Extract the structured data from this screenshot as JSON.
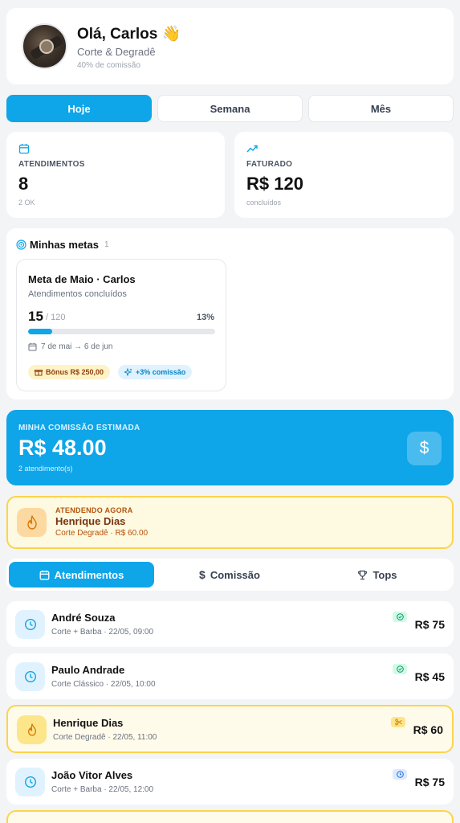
{
  "profile": {
    "greeting": "Olá, Carlos 👋",
    "role": "Corte & Degradê",
    "commission_rate": "40% de comissão"
  },
  "periods": [
    "Hoje",
    "Semana",
    "Mês"
  ],
  "stats": {
    "appointments": {
      "label": "ATENDIMENTOS",
      "value": "8",
      "sub": "2 OK"
    },
    "revenue": {
      "label": "FATURADO",
      "value": "R$ 120",
      "sub": "concluídos"
    }
  },
  "goals": {
    "title": "Minhas metas",
    "count": "1",
    "goal": {
      "name": "Meta de Maio · Carlos",
      "description": "Atendimentos concluídos",
      "current": "15",
      "total": "/ 120",
      "percent_label": "13%",
      "progress": 0.13,
      "dates": "7 de mai → 6 de jun",
      "bonus": "Bônus R$ 250,00",
      "extra": "+3% comissão"
    }
  },
  "commission": {
    "label": "MINHA COMISSÃO ESTIMADA",
    "value": "R$ 48.00",
    "sub": "2 atendimento(s)",
    "icon": "$"
  },
  "now_serving": {
    "label": "ATENDENDO AGORA",
    "name": "Henrique Dias",
    "sub": "Corte Degradê · R$ 60.00"
  },
  "tabs": [
    "Atendimentos",
    "Comissão",
    "Tops"
  ],
  "appointments": [
    {
      "name": "André Souza",
      "service": "Corte + Barba · 22/05, 09:00",
      "price": "R$ 75",
      "status": "done"
    },
    {
      "name": "Paulo Andrade",
      "service": "Corte Clássico · 22/05, 10:00",
      "price": "R$ 45",
      "status": "done"
    },
    {
      "name": "Henrique Dias",
      "service": "Corte Degradê · 22/05, 11:00",
      "price": "R$ 60",
      "status": "in-progress"
    },
    {
      "name": "João Vitor Alves",
      "service": "Corte + Barba · 22/05, 12:00",
      "price": "R$ 75",
      "status": "scheduled"
    }
  ],
  "colors": {
    "accent": "#0ea5e9",
    "highlight_border": "#fcd34d",
    "highlight_bg": "#fef9e1"
  }
}
